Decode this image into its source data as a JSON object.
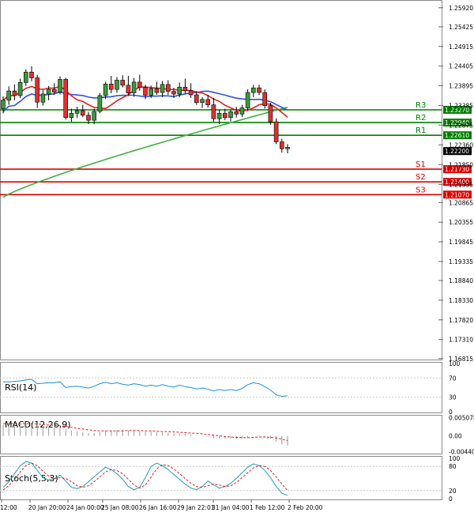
{
  "chart_data": [
    {
      "type": "candlestick",
      "panel": "price",
      "title": "",
      "y_ticks": [
        "1.25920",
        "1.25425",
        "1.24915",
        "1.24405",
        "1.23895",
        "1.23385",
        "1.22875",
        "1.22360",
        "1.21850",
        "1.21335",
        "1.20865",
        "1.20355",
        "1.19845",
        "1.19335",
        "1.18840",
        "1.18330",
        "1.17820",
        "1.17310",
        "1.16815"
      ],
      "ylim": [
        1.1679,
        1.261
      ],
      "current_price": {
        "value": 1.222,
        "label": "1.22200"
      },
      "levels": [
        {
          "name": "R3",
          "value": 1.2327,
          "label": "1.23270",
          "color": "#008000"
        },
        {
          "name": "R2",
          "value": 1.2294,
          "label": "1.22940",
          "color": "#008000"
        },
        {
          "name": "R1",
          "value": 1.2261,
          "label": "1.22610",
          "color": "#008000"
        },
        {
          "name": "S1",
          "value": 1.2173,
          "label": "1.21730",
          "color": "#e00000"
        },
        {
          "name": "S2",
          "value": 1.214,
          "label": "1.21400",
          "color": "#e00000"
        },
        {
          "name": "S3",
          "value": 1.2107,
          "label": "1.21070",
          "color": "#e00000"
        }
      ],
      "x_ticks": [
        "12:00",
        "20 Jan 20:00",
        "24 Jan 00:00",
        "25 Jan 08:00",
        "26 Jan 16:00",
        "29 Jan 22:01",
        "31 Jan 04:00",
        "1 Feb 12:00",
        "2 Feb 20:00"
      ],
      "candles": [
        [
          1.233,
          1.2362,
          1.2318,
          1.2352
        ],
        [
          1.2352,
          1.2388,
          1.234,
          1.2376
        ],
        [
          1.2376,
          1.2393,
          1.2352,
          1.2364
        ],
        [
          1.2364,
          1.2408,
          1.2358,
          1.2398
        ],
        [
          1.2398,
          1.2432,
          1.2389,
          1.2425
        ],
        [
          1.2425,
          1.244,
          1.2401,
          1.241
        ],
        [
          1.241,
          1.2418,
          1.2332,
          1.2347
        ],
        [
          1.2347,
          1.2378,
          1.2338,
          1.2368
        ],
        [
          1.2368,
          1.2389,
          1.2352,
          1.238
        ],
        [
          1.238,
          1.2396,
          1.2366,
          1.2373
        ],
        [
          1.2373,
          1.2414,
          1.2367,
          1.2406
        ],
        [
          1.2406,
          1.241,
          1.2302,
          1.2307
        ],
        [
          1.2307,
          1.233,
          1.2296,
          1.2318
        ],
        [
          1.2318,
          1.2335,
          1.2306,
          1.2325
        ],
        [
          1.2325,
          1.234,
          1.2308,
          1.2313
        ],
        [
          1.2313,
          1.2322,
          1.229,
          1.23
        ],
        [
          1.23,
          1.233,
          1.229,
          1.2323
        ],
        [
          1.2323,
          1.237,
          1.2318,
          1.2364
        ],
        [
          1.2364,
          1.24,
          1.2355,
          1.2394
        ],
        [
          1.2394,
          1.2415,
          1.237,
          1.238
        ],
        [
          1.238,
          1.2412,
          1.2371,
          1.2404
        ],
        [
          1.2404,
          1.2417,
          1.2385,
          1.2391
        ],
        [
          1.2391,
          1.2415,
          1.2363,
          1.2371
        ],
        [
          1.2371,
          1.241,
          1.2361,
          1.2399
        ],
        [
          1.2399,
          1.2418,
          1.2377,
          1.2385
        ],
        [
          1.2385,
          1.2392,
          1.2355,
          1.2365
        ],
        [
          1.2365,
          1.239,
          1.2358,
          1.2382
        ],
        [
          1.2382,
          1.24,
          1.2366,
          1.2372
        ],
        [
          1.2372,
          1.2402,
          1.236,
          1.2393
        ],
        [
          1.2393,
          1.2404,
          1.2366,
          1.2375
        ],
        [
          1.2375,
          1.2384,
          1.2358,
          1.2368
        ],
        [
          1.2368,
          1.2398,
          1.236,
          1.2386
        ],
        [
          1.2386,
          1.2408,
          1.2369,
          1.2377
        ],
        [
          1.2377,
          1.2396,
          1.2358,
          1.2366
        ],
        [
          1.2366,
          1.2376,
          1.234,
          1.2346
        ],
        [
          1.2346,
          1.236,
          1.2332,
          1.2354
        ],
        [
          1.2354,
          1.2366,
          1.2333,
          1.234
        ],
        [
          1.234,
          1.2358,
          1.2296,
          1.2304
        ],
        [
          1.2304,
          1.2328,
          1.229,
          1.2318
        ],
        [
          1.2318,
          1.233,
          1.23,
          1.2307
        ],
        [
          1.2307,
          1.2328,
          1.2297,
          1.2322
        ],
        [
          1.2322,
          1.2335,
          1.2307,
          1.2316
        ],
        [
          1.2316,
          1.234,
          1.2308,
          1.2332
        ],
        [
          1.2332,
          1.238,
          1.2325,
          1.2372
        ],
        [
          1.2372,
          1.2392,
          1.236,
          1.2384
        ],
        [
          1.2384,
          1.2392,
          1.2365,
          1.2372
        ],
        [
          1.2372,
          1.238,
          1.233,
          1.2338
        ],
        [
          1.2338,
          1.2345,
          1.2288,
          1.2296
        ],
        [
          1.2296,
          1.2305,
          1.2238,
          1.2244
        ],
        [
          1.2244,
          1.2252,
          1.2216,
          1.2226
        ],
        [
          1.2226,
          1.2238,
          1.2214,
          1.223
        ]
      ]
    },
    {
      "type": "line",
      "panel": "rsi",
      "label": "RSI(14)",
      "y_ticks": [
        "100",
        "70",
        "30",
        "0"
      ],
      "ylim": [
        0,
        100
      ],
      "values": [
        62,
        62,
        63,
        64,
        66,
        67,
        58,
        59,
        60,
        60,
        62,
        50,
        52,
        53,
        51,
        49,
        53,
        58,
        61,
        58,
        60,
        57,
        55,
        58,
        56,
        53,
        55,
        53,
        56,
        53,
        51,
        55,
        52,
        50,
        47,
        49,
        47,
        43,
        46,
        44,
        46,
        44,
        48,
        56,
        60,
        58,
        52,
        45,
        35,
        32,
        33
      ]
    },
    {
      "type": "histogram",
      "panel": "macd",
      "label": "MACD(12,26,9)",
      "y_ticks": [
        "0.005078",
        "0.00",
        "-0.004402"
      ],
      "ylim": [
        -0.0047,
        0.0054
      ],
      "macd": [
        0.003,
        0.0031,
        0.0032,
        0.0033,
        0.0034,
        0.0035,
        0.0031,
        0.0028,
        0.0026,
        0.0024,
        0.0024,
        0.0018,
        0.0015,
        0.0013,
        0.001,
        0.0008,
        0.0008,
        0.0011,
        0.0014,
        0.0015,
        0.0016,
        0.0016,
        0.0015,
        0.0015,
        0.0014,
        0.0012,
        0.0012,
        0.001,
        0.001,
        0.0009,
        0.0007,
        0.0007,
        0.0006,
        0.0004,
        0.0001,
        0.0,
        -0.0002,
        -0.0006,
        -0.0007,
        -0.0008,
        -0.0008,
        -0.0009,
        -0.0008,
        -0.0004,
        0.0,
        0.0001,
        -0.0002,
        -0.0008,
        -0.0016,
        -0.0023,
        -0.0027
      ],
      "signal": [
        0.0034,
        0.0034,
        0.0034,
        0.0034,
        0.0034,
        0.0034,
        0.0033,
        0.0032,
        0.003,
        0.0029,
        0.0028,
        0.0026,
        0.0024,
        0.0021,
        0.0019,
        0.0017,
        0.0015,
        0.0014,
        0.0014,
        0.0014,
        0.0014,
        0.0014,
        0.0015,
        0.0015,
        0.0015,
        0.0014,
        0.0014,
        0.0013,
        0.0012,
        0.0012,
        0.0011,
        0.001,
        0.0009,
        0.0008,
        0.0007,
        0.0006,
        0.0004,
        0.0002,
        0.0,
        -0.0002,
        -0.0003,
        -0.0004,
        -0.0005,
        -0.0005,
        -0.0004,
        -0.0003,
        -0.0003,
        -0.0004,
        -0.0006,
        -0.0009,
        -0.0013
      ]
    },
    {
      "type": "line",
      "panel": "stoch",
      "label": "Stoch(5,5,3)",
      "y_ticks": [
        "100",
        "80",
        "20",
        "0"
      ],
      "ylim": [
        0,
        100
      ],
      "main": [
        28,
        42,
        62,
        82,
        92,
        88,
        70,
        52,
        46,
        50,
        58,
        44,
        28,
        25,
        30,
        42,
        54,
        66,
        78,
        72,
        62,
        48,
        30,
        22,
        28,
        52,
        80,
        88,
        82,
        72,
        60,
        48,
        36,
        26,
        22,
        30,
        44,
        34,
        26,
        30,
        38,
        50,
        64,
        78,
        86,
        82,
        70,
        52,
        30,
        14,
        8
      ],
      "signal": [
        22,
        32,
        48,
        66,
        82,
        88,
        82,
        68,
        56,
        50,
        52,
        50,
        42,
        32,
        28,
        32,
        42,
        54,
        66,
        72,
        70,
        62,
        48,
        34,
        26,
        34,
        54,
        74,
        84,
        82,
        74,
        62,
        50,
        38,
        30,
        28,
        32,
        36,
        34,
        30,
        32,
        40,
        52,
        64,
        76,
        82,
        80,
        70,
        54,
        36,
        20
      ]
    }
  ],
  "colors": {
    "bull": "#3a9a3a",
    "bear": "#e03030",
    "ma_red": "#e02020",
    "ma_blue": "#3050e0",
    "ma_green": "#40b040",
    "indicator": "#1a8fe0",
    "signal": "#e02020"
  }
}
